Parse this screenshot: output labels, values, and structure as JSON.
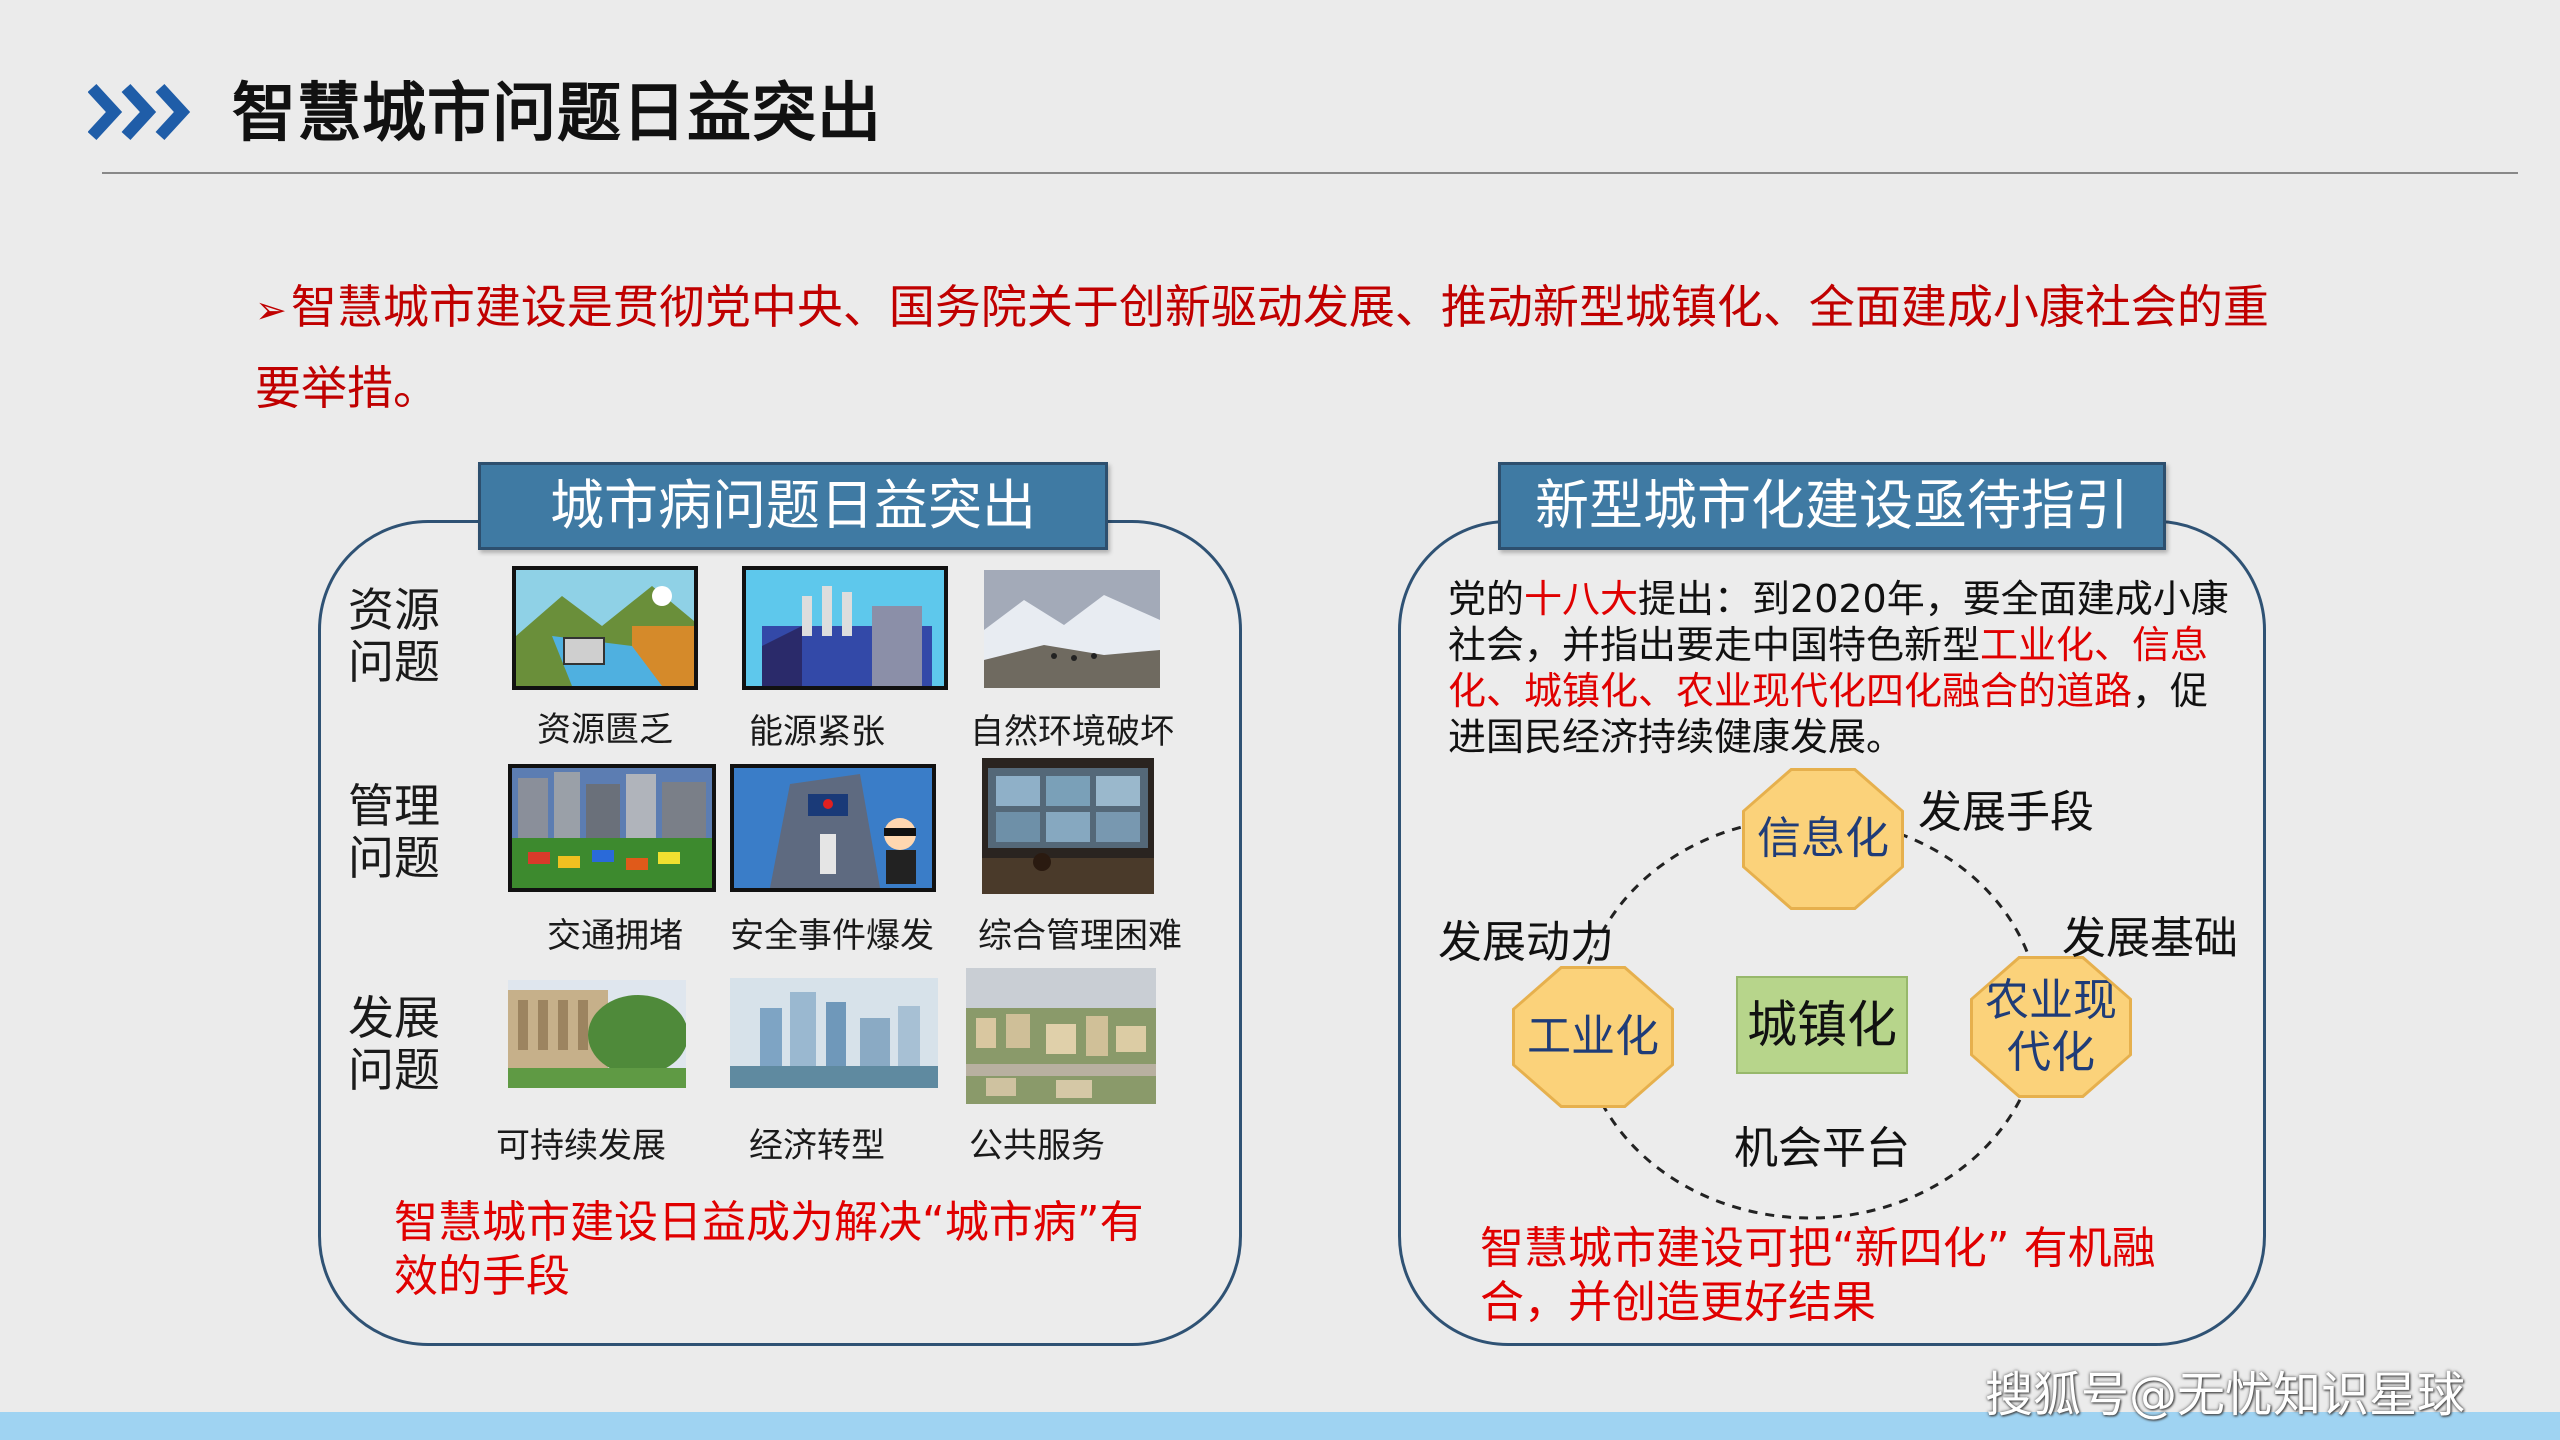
{
  "header": {
    "title": "智慧城市问题日益突出"
  },
  "intro": {
    "text": "智慧城市建设是贯彻党中央、国务院关于创新驱动发展、推动新型城镇化、全面建成小康社会的重要举措。"
  },
  "left_panel": {
    "title": "城市病问题日益突出",
    "rows": [
      {
        "label": "资源\n问题",
        "captions": [
          "资源匮乏",
          "能源紧张",
          "自然环境破坏"
        ]
      },
      {
        "label": "管理\n问题",
        "captions": [
          "交通拥堵",
          "安全事件爆发",
          "综合管理困难"
        ]
      },
      {
        "label": "发展\n问题",
        "captions": [
          "可持续发展",
          "经济转型",
          "公共服务"
        ]
      }
    ],
    "footer": "智慧城市建设日益成为解决“城市病”有效的手段"
  },
  "right_panel": {
    "title": "新型城市化建设亟待指引",
    "para_1": "党的",
    "para_red_1": "十八大",
    "para_2": "提出：到2020年，要全面建成小康社会，并指出要走中国特色新型",
    "para_red_2": "工业化、信息化、城镇化、农业现代化四化融合的道路",
    "para_3": "，促进国民经济持续健康发展。",
    "nodes": {
      "top": "信息化",
      "left": "工业化",
      "right": "农业现\n代化",
      "center": "城镇化"
    },
    "labels": {
      "top_right": "发展手段",
      "left": "发展动力",
      "right": "发展基础",
      "bottom": "机会平台"
    },
    "footer": "智慧城市建设可把“新四化” 有机融合，并创造更好结果"
  },
  "watermark": "搜狐号@无忧知识星球",
  "colors": {
    "accent_red": "#e00000",
    "header_blue": "#3f7aa3",
    "octagon": "#fbd27a",
    "center": "#b7d58b"
  }
}
